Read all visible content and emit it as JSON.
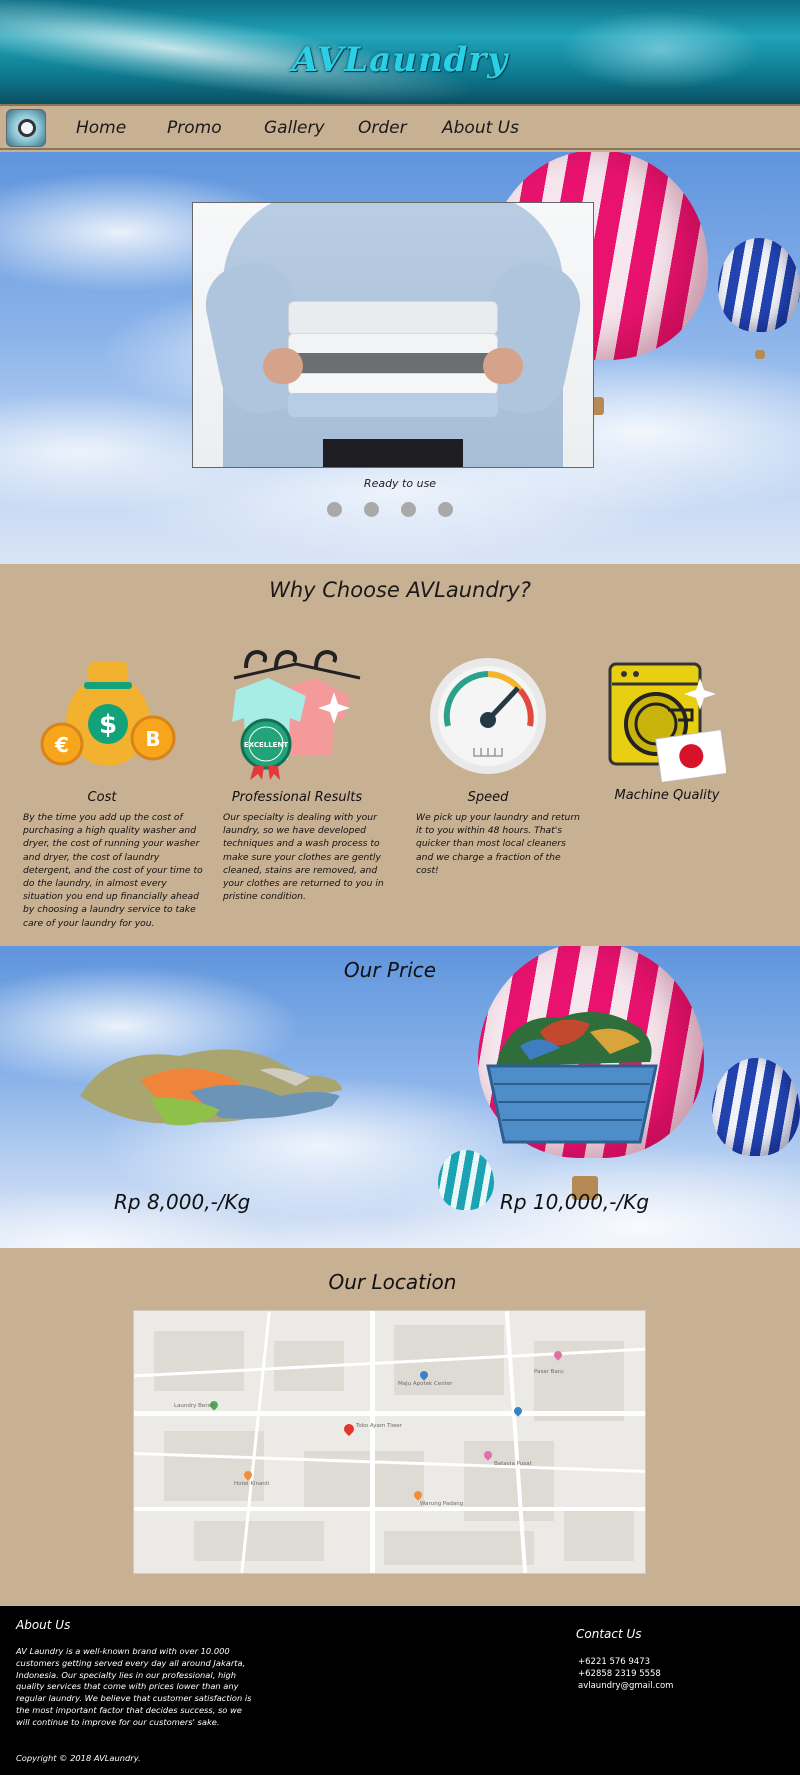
{
  "header": {
    "brand": "AVLaundry"
  },
  "nav": {
    "items": [
      "Home",
      "Promo",
      "Gallery",
      "Order",
      "About Us"
    ]
  },
  "slider": {
    "caption": "Ready to use",
    "dot_count": 4
  },
  "why": {
    "title": "Why Choose AVLaundry?",
    "features": [
      {
        "title": "Cost",
        "text": "By the time you add up the cost of purchasing a high quality washer and dryer, the cost of running your washer and dryer, the cost of laundry detergent, and the cost of your time to do the laundry, in almost every situation you end up financially ahead by choosing a laundry service to take care of your laundry for you."
      },
      {
        "title": "Professional Results",
        "text": "Our specialty is dealing with your laundry, so we have developed techniques and a wash process to make sure your clothes are gently cleaned, stains are removed, and your clothes are returned to you in pristine condition."
      },
      {
        "title": "Speed",
        "text": "We pick up your laundry and return it to you within 48 hours.  That's quicker than most local cleaners and we charge a fraction of the cost!"
      },
      {
        "title": "Machine Quality",
        "text": ""
      }
    ],
    "badge_text": "EXCELLENT"
  },
  "price": {
    "title": "Our Price",
    "items": [
      {
        "label": "Rp 8,000,-/Kg"
      },
      {
        "label": "Rp 10,000,-/Kg"
      }
    ]
  },
  "location": {
    "title": "Our Location",
    "map_labels": [
      "Toko Ayam Tiwer",
      "Batavia Pusat",
      "Maju Apotek Center",
      "Hotel Kinanti",
      "Laundry Bersih",
      "Warung Padang",
      "Pasar Baru"
    ]
  },
  "footer": {
    "about_title": "About Us",
    "about_text": "AV Laundry is a well-known brand with over 10.000 customers getting served every day all around Jakarta, Indonesia. Our specialty lies in our professional, high quality services that come with prices lower than any regular laundry. We believe that customer satisfaction is the most important factor that decides success, so we will continue to improve for our customers' sake.",
    "contact_title": "Contact Us",
    "phone1": "+6221 576 9473",
    "phone2": "+62858 2319 5558",
    "email": "avlaundry@gmail.com",
    "copyright": "Copyright © 2018 AVLaundry."
  },
  "colors": {
    "tan": "#c8b093",
    "footer": "#000000",
    "banner": "#1a8fa5",
    "brand_text": "#2ad0e6"
  }
}
